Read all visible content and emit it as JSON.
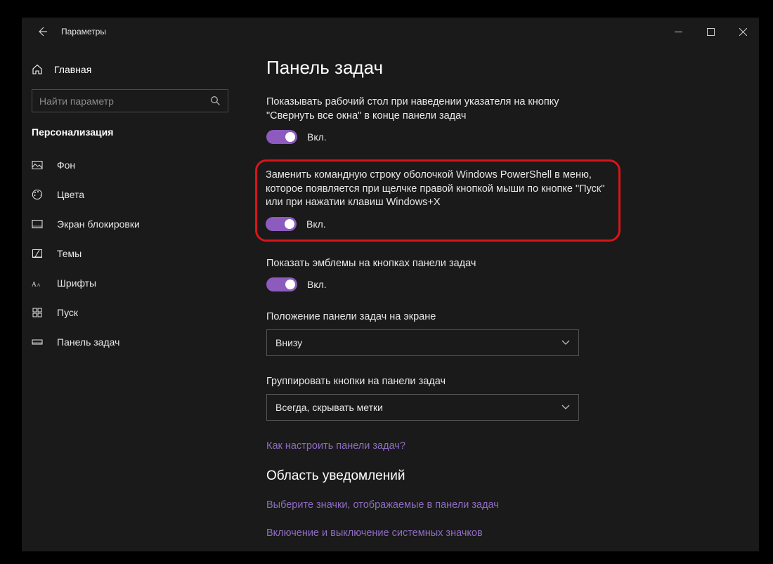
{
  "titlebar": {
    "title": "Параметры"
  },
  "sidebar": {
    "home": "Главная",
    "search_placeholder": "Найти параметр",
    "section": "Персонализация",
    "items": [
      {
        "label": "Фон"
      },
      {
        "label": "Цвета"
      },
      {
        "label": "Экран блокировки"
      },
      {
        "label": "Темы"
      },
      {
        "label": "Шрифты"
      },
      {
        "label": "Пуск"
      },
      {
        "label": "Панель задач"
      }
    ]
  },
  "page": {
    "title": "Панель задач",
    "setting1": {
      "text": "Показывать рабочий стол при наведении указателя на кнопку \"Свернуть все окна\" в конце панели задач",
      "state": "Вкл."
    },
    "setting2": {
      "text": "Заменить командную строку оболочкой Windows PowerShell в меню, которое появляется при щелчке правой кнопкой мыши по кнопке \"Пуск\" или при нажатии клавиш Windows+X",
      "state": "Вкл."
    },
    "setting3": {
      "text": "Показать эмблемы на кнопках панели задач",
      "state": "Вкл."
    },
    "position": {
      "label": "Положение панели задач на экране",
      "value": "Внизу"
    },
    "grouping": {
      "label": "Группировать кнопки на панели задач",
      "value": "Всегда, скрывать метки"
    },
    "link1": "Как настроить панели задач?",
    "area_header": "Область уведомлений",
    "link2": "Выберите значки, отображаемые в панели задач",
    "link3": "Включение и выключение системных значков"
  }
}
